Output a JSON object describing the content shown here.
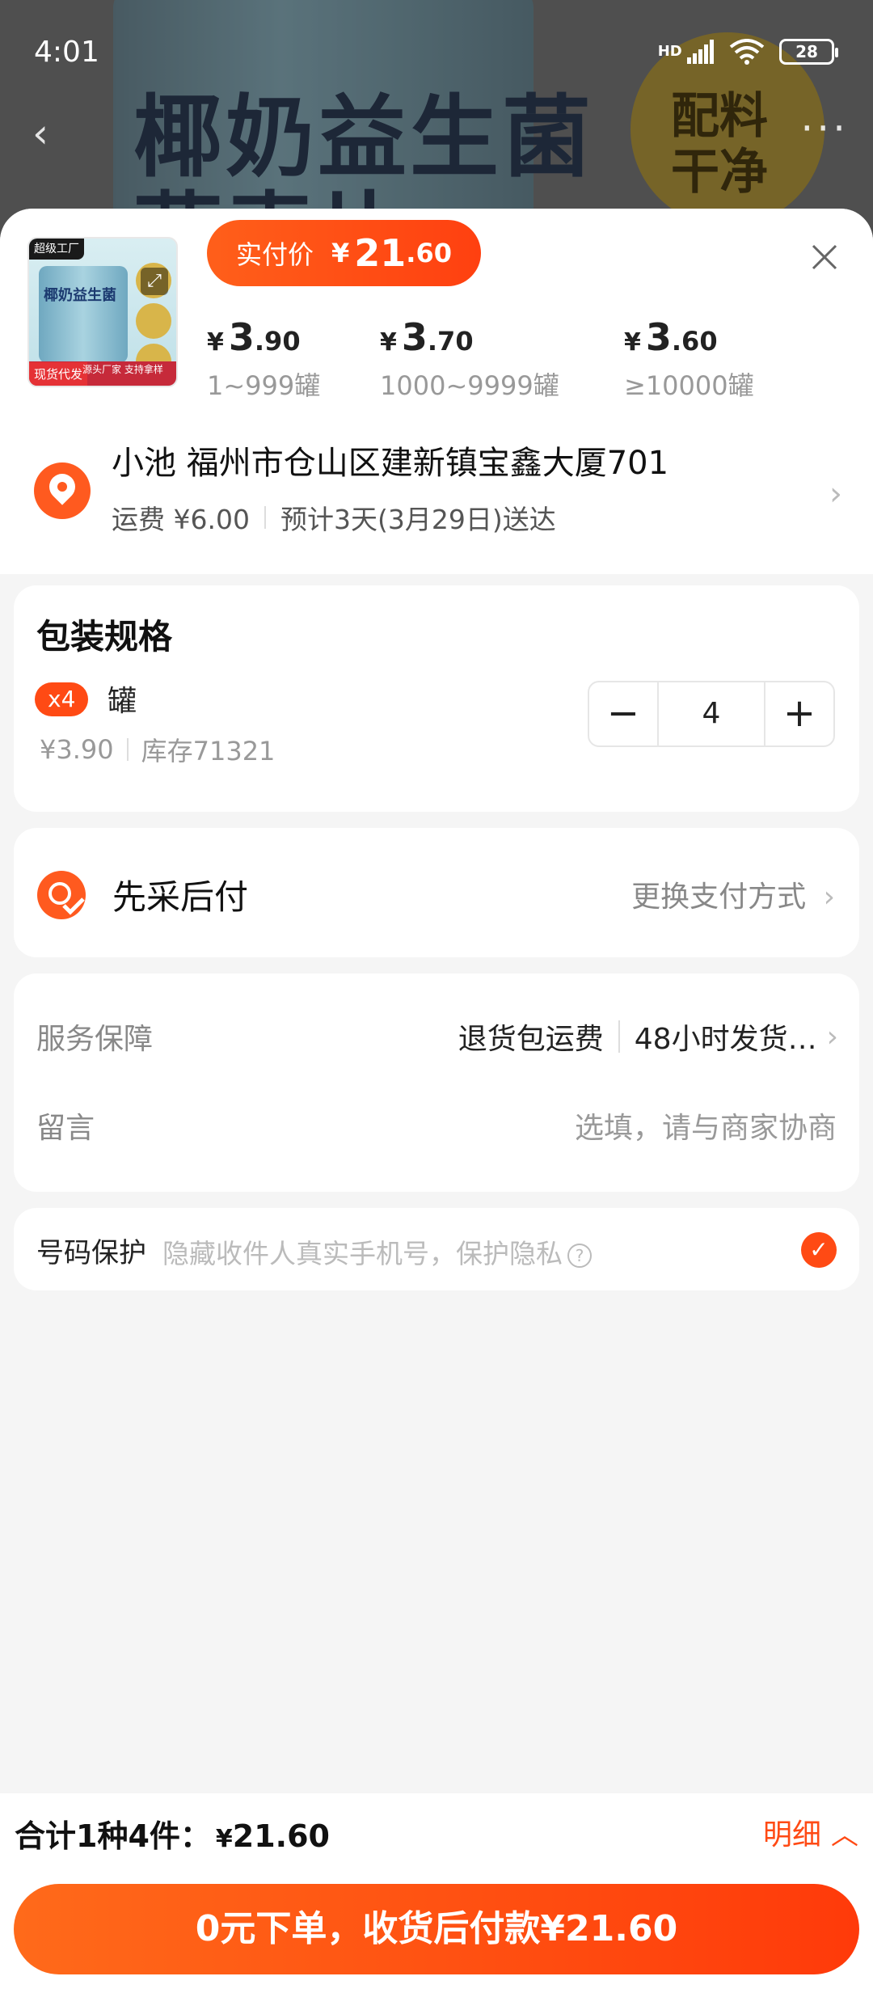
{
  "status": {
    "time": "4:01",
    "network": "HD",
    "battery": "28"
  },
  "background": {
    "product_title_line1": "椰奶益生菌",
    "product_title_line2": "燕麦片",
    "badge_text": "配料干净"
  },
  "header": {
    "price_label": "实付价",
    "price_currency": "¥",
    "price_int": "21",
    "price_dec": ".60",
    "tiers": [
      {
        "currency": "¥",
        "int": "3",
        "dec": ".90",
        "range": "1~999罐"
      },
      {
        "currency": "¥",
        "int": "3",
        "dec": ".70",
        "range": "1000~9999罐"
      },
      {
        "currency": "¥",
        "int": "3",
        "dec": ".60",
        "range": "≥10000罐"
      }
    ],
    "thumb": {
      "badge": "超级工厂",
      "tag": "现货代发",
      "caption": "源头厂家 支持拿样"
    }
  },
  "address": {
    "name_line": "小池 福州市仓山区建新镇宝鑫大厦701",
    "shipping": "运费 ¥6.00",
    "delivery": "预计3天(3月29日)送达"
  },
  "spec": {
    "title": "包装规格",
    "tag": "x4",
    "unit": "罐",
    "price": "¥3.90",
    "stock": "库存71321",
    "quantity": "4",
    "minus": "−",
    "plus": "+"
  },
  "payment": {
    "title": "先采后付",
    "switch_label": "更换支付方式"
  },
  "service": {
    "label": "服务保障",
    "value1": "退货包运费",
    "value2": "48小时发货…",
    "note_label": "留言",
    "note_placeholder": "选填，请与商家协商"
  },
  "privacy": {
    "label": "号码保护",
    "desc": "隐藏收件人真实手机号，保护隐私"
  },
  "footer": {
    "total_label": "合计1种4件：",
    "total_currency": "¥",
    "total_value": "21.60",
    "detail_label": "明细",
    "submit_label": "0元下单，收货后付款¥21.60"
  },
  "colors": {
    "accent": "#ff4a14",
    "background": "#f5f5f5"
  }
}
